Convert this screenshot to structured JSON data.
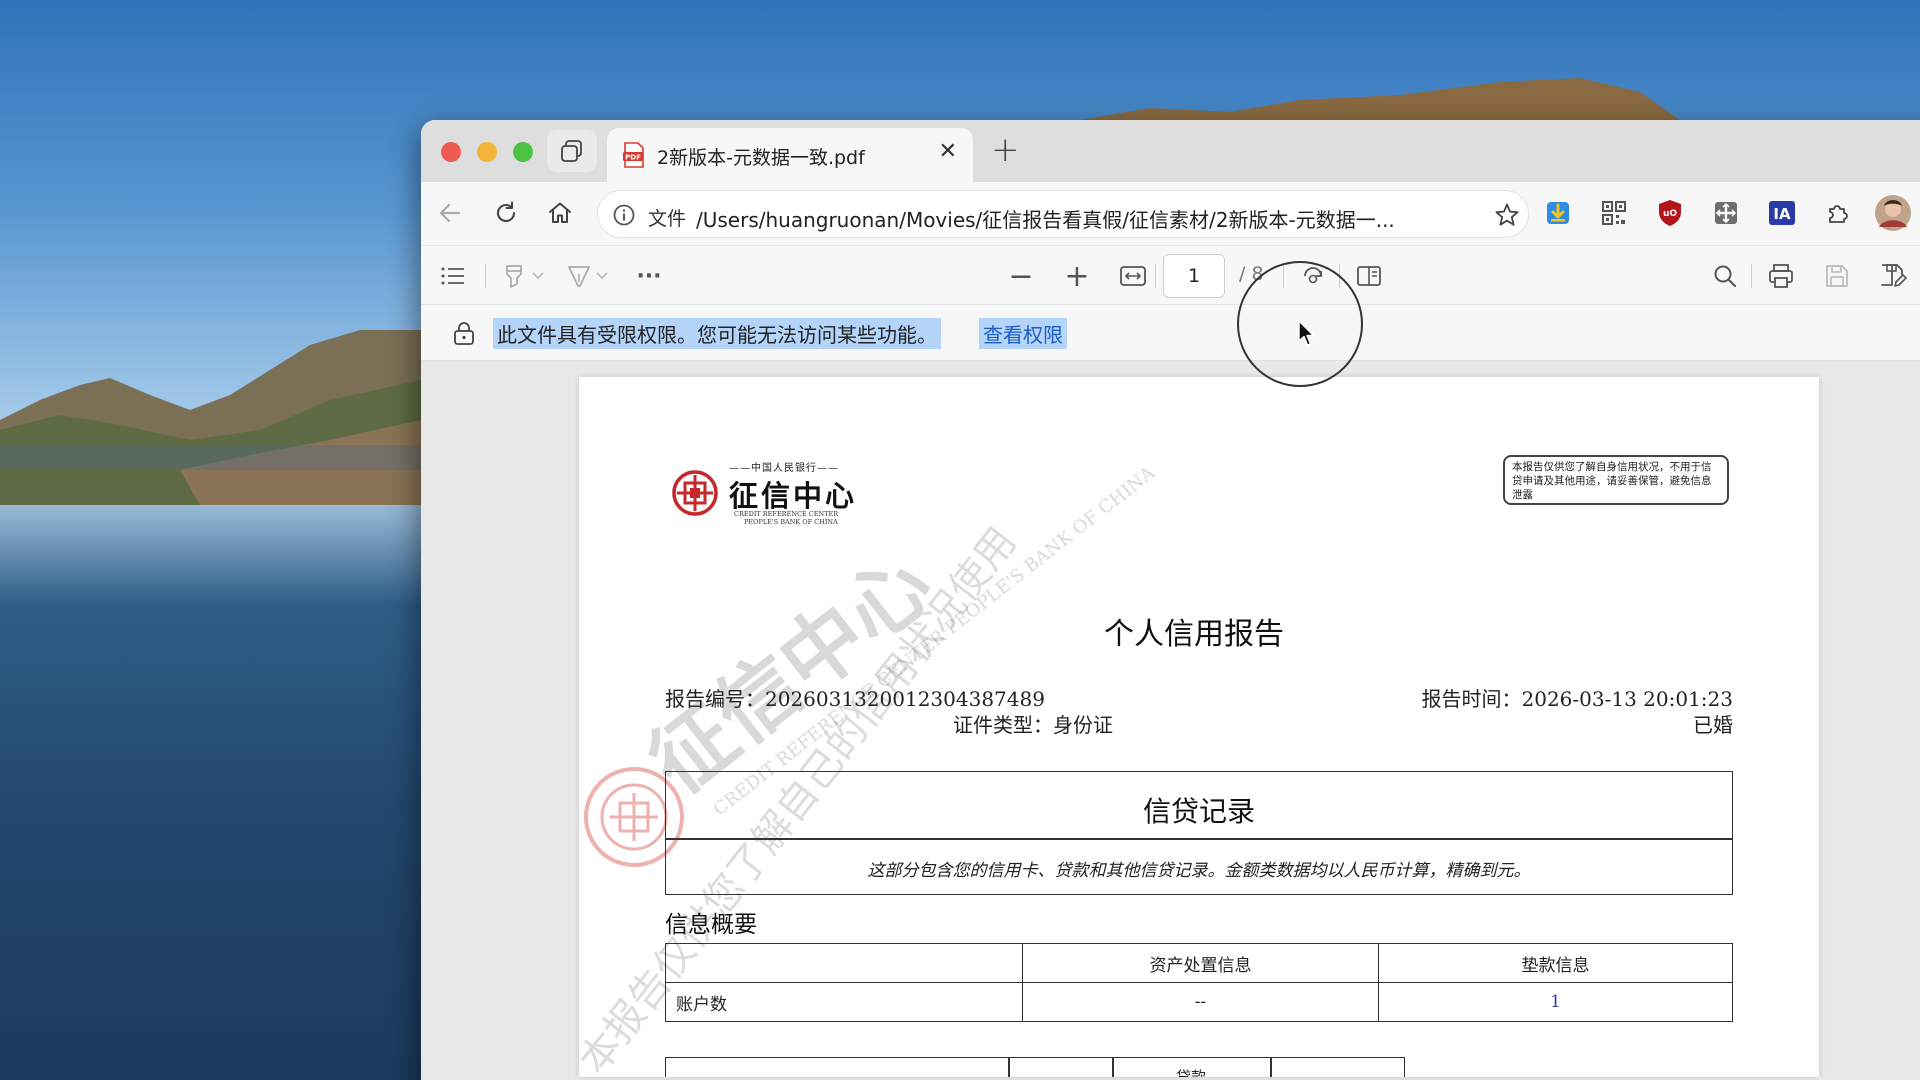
{
  "tab": {
    "title": "2新版本-元数据一致.pdf"
  },
  "address_bar": {
    "scheme_label": "文件",
    "url": "/Users/huangruonan/Movies/征信报告看真假/征信素材/2新版本-元数据一..."
  },
  "pdf_toolbar": {
    "more_label": "···",
    "zoom_out_label": "−",
    "zoom_in_label": "+",
    "page_number": "1",
    "page_total": "/ 8"
  },
  "notice": {
    "text": "此文件具有受限权限。您可能无法访问某些功能。",
    "link": "查看权限"
  },
  "document": {
    "logo": {
      "top_text": "——中国人民银行——",
      "main_text": "征信中心",
      "en_line1": "CREDIT REFERENCE CENTER",
      "en_line2": "PEOPLE'S BANK OF CHINA"
    },
    "disclaimer": "本报告仅供您了解自身信用状况，不用于信贷申请及其他用途，请妥善保管，避免信息泄露",
    "title": "个人信用报告",
    "report_no_label": "报告编号：",
    "report_no": "2026031320012304387489",
    "report_time_label": "报告时间：",
    "report_time": "2026-03-13 20:01:23",
    "id_type_label": "证件类型：",
    "id_type": "身份证",
    "marital_status": "已婚",
    "credit_section": {
      "title": "信贷记录",
      "description": "这部分包含您的信用卡、贷款和其他信贷记录。金额类数据均以人民币计算，精确到元。"
    },
    "summary": {
      "title": "信息概要",
      "headers": [
        "",
        "资产处置信息",
        "垫款信息"
      ],
      "rows": [
        [
          "账户数",
          "--",
          "1"
        ]
      ]
    },
    "next_table_label": "贷款",
    "watermark_text": "征信中心",
    "watermark_en": "CREDIT REFERENCE CENTER  PEOPLE'S BANK OF CHINA",
    "watermark_diag": "本报告仅供您了解自己的信用状况使用"
  },
  "colors": {
    "selection": "#b5d4f9",
    "link": "#1a5dc5",
    "seal": "#d9534f"
  }
}
